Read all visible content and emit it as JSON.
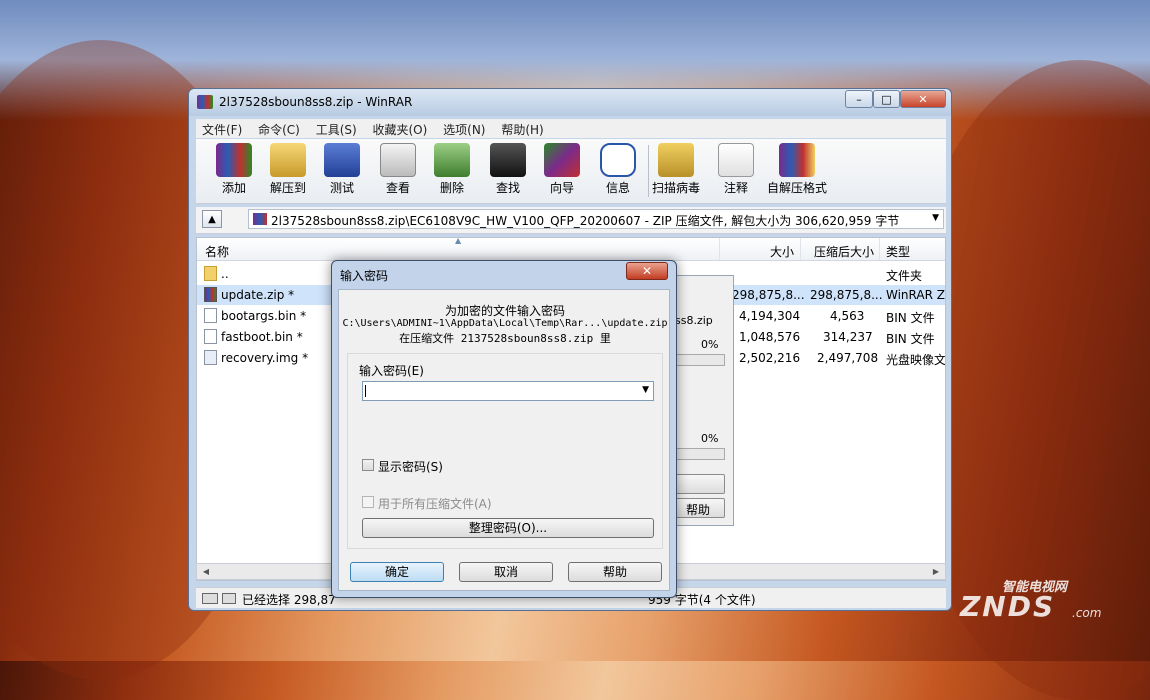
{
  "window": {
    "title": "2l37528sboun8ss8.zip - WinRAR",
    "controls": [
      "–",
      "□",
      "✕"
    ]
  },
  "menu": [
    "文件(F)",
    "命令(C)",
    "工具(S)",
    "收藏夹(O)",
    "选项(N)",
    "帮助(H)"
  ],
  "toolbar": [
    {
      "label": "添加",
      "icon": "add-archive-icon"
    },
    {
      "label": "解压到",
      "icon": "extract-to-icon"
    },
    {
      "label": "测试",
      "icon": "test-icon"
    },
    {
      "label": "查看",
      "icon": "view-icon"
    },
    {
      "label": "删除",
      "icon": "delete-icon"
    },
    {
      "label": "查找",
      "icon": "find-icon"
    },
    {
      "label": "向导",
      "icon": "wizard-icon"
    },
    {
      "label": "信息",
      "icon": "info-icon"
    },
    {
      "label": "扫描病毒",
      "icon": "virus-scan-icon"
    },
    {
      "label": "注释",
      "icon": "comment-icon"
    },
    {
      "label": "自解压格式",
      "icon": "sfx-icon"
    }
  ],
  "address": {
    "path": "2l37528sboun8ss8.zip\\EC6108V9C_HW_V100_QFP_20200607 - ZIP 压缩文件, 解包大小为 306,620,959 字节"
  },
  "columns": {
    "name": "名称",
    "size": "大小",
    "packed": "压缩后大小",
    "type": "类型"
  },
  "files": [
    {
      "name": "..",
      "size": "",
      "packed": "",
      "type": "文件夹",
      "icon": "folder-icon"
    },
    {
      "name": "update.zip *",
      "size": "298,875,8...",
      "packed": "298,875,8...",
      "type": "WinRAR ZI",
      "icon": "rar-archive-icon"
    },
    {
      "name": "bootargs.bin *",
      "size": "4,194,304",
      "packed": "4,563",
      "type": "BIN 文件",
      "icon": "file-icon"
    },
    {
      "name": "fastboot.bin *",
      "size": "1,048,576",
      "packed": "314,237",
      "type": "BIN 文件",
      "icon": "file-icon"
    },
    {
      "name": "recovery.img *",
      "size": "2,502,216",
      "packed": "2,497,708",
      "type": "光盘映像文",
      "icon": "disc-image-icon"
    }
  ],
  "status": {
    "selected": "已经选择 298,87",
    "total": "959 字节(4 个文件)"
  },
  "progress_panel": {
    "file_fragment": "ss8.zip",
    "percent1": "0%",
    "percent2": "0%",
    "help_fragment": "帮助"
  },
  "dialog": {
    "title": "输入密码",
    "close": "✕",
    "line1": "为加密的文件输入密码",
    "line2": "C:\\Users\\ADMINI~1\\AppData\\Local\\Temp\\Rar...\\update.zip",
    "line3": "在压缩文件 2137528sboun8ss8.zip 里",
    "password_label": "输入密码(E)",
    "password_value": "",
    "show_password": "显示密码(S)",
    "use_for_all": "用于所有压缩文件(A)",
    "organize": "整理密码(O)...",
    "ok": "确定",
    "cancel": "取消",
    "help": "帮助"
  },
  "watermark": {
    "cn": "智能电视网",
    "brand": "ZNDS",
    "suffix": ".com"
  }
}
